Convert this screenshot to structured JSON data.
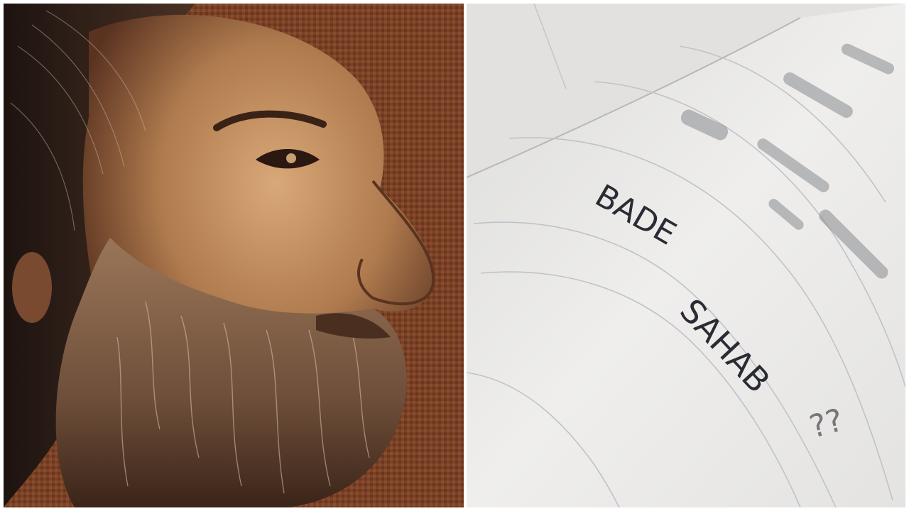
{
  "collage": {
    "left_photo": {
      "subject": "portrait-profile-photo"
    },
    "right_photo": {
      "subject": "notebook-page-photo",
      "handwritten_line1": "BADE",
      "handwritten_line2": "SAHAB",
      "handwritten_marks": "??"
    }
  },
  "colors": {
    "left_bg": "#6b3a22",
    "skin": "#c08a5c",
    "beard": "#8a6a50",
    "paper": "#ecebe8",
    "ink": "#2a2c34"
  }
}
